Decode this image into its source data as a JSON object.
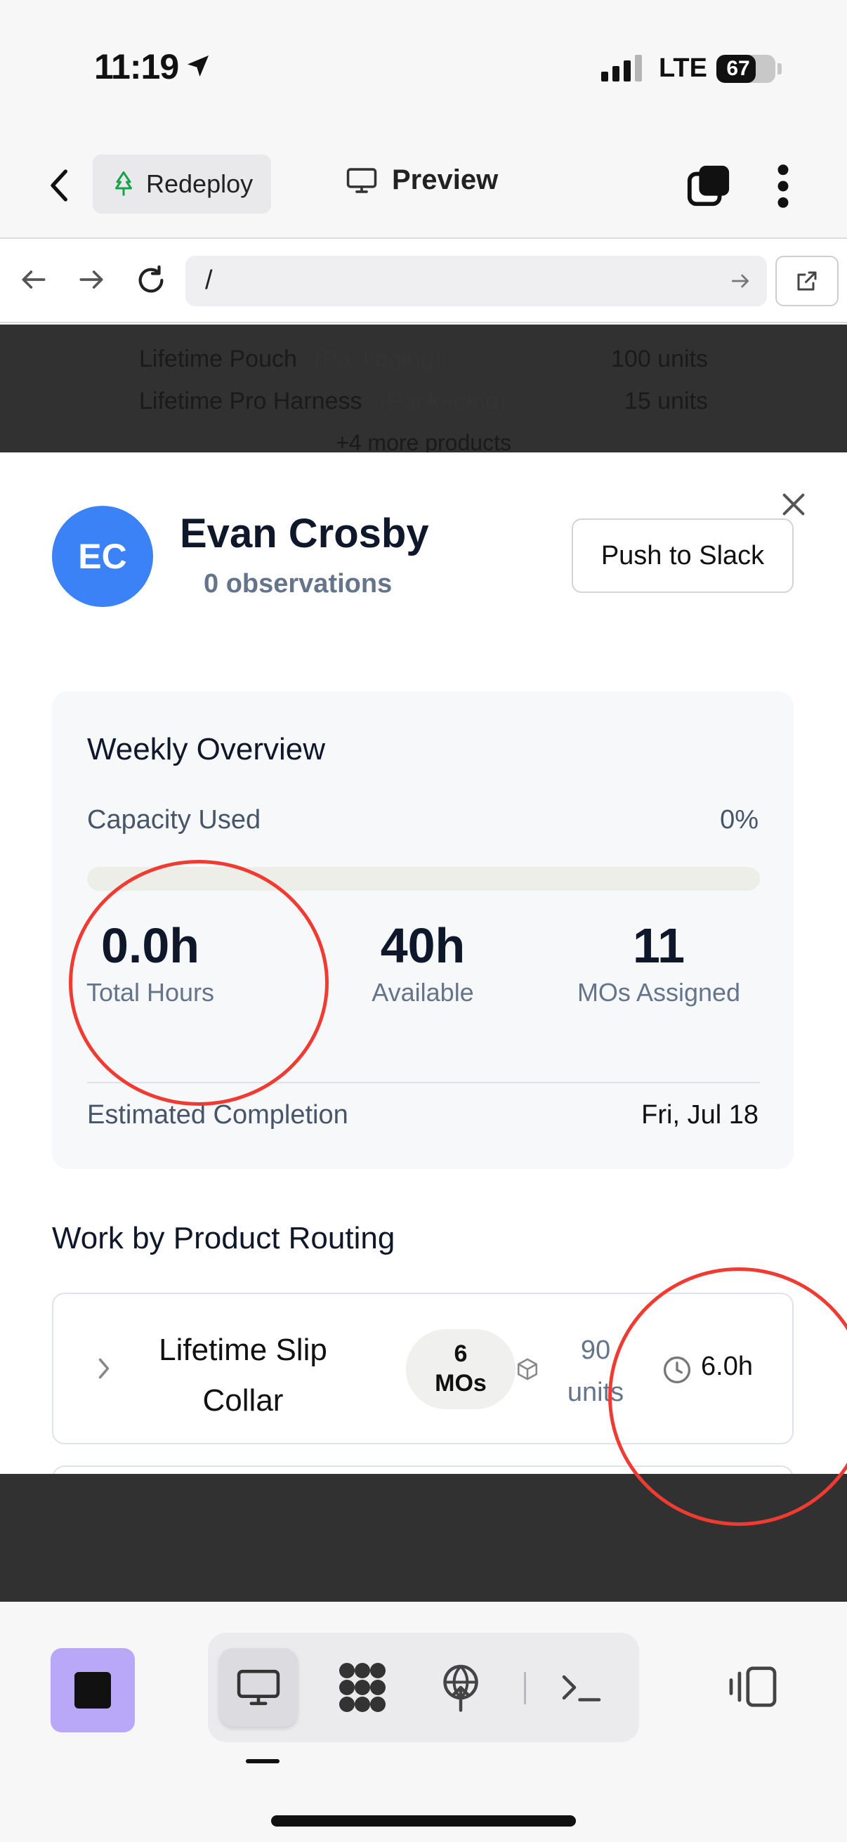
{
  "status_bar": {
    "time": "11:19",
    "network": "LTE",
    "battery": "67",
    "battery_fraction": 0.67
  },
  "top_nav": {
    "redeploy_label": "Redeploy",
    "preview_label": "Preview"
  },
  "url_bar": {
    "path": "/"
  },
  "background_list": {
    "rows": [
      {
        "name": "Lifetime Pouch",
        "category": "(Packaging)",
        "qty": "100 units"
      },
      {
        "name": "Lifetime Pro Harness",
        "category": "(Packaging)",
        "qty": "15 units"
      }
    ],
    "more": "+4 more products"
  },
  "modal": {
    "avatar_initials": "EC",
    "name": "Evan Crosby",
    "observations": "0 observations",
    "push_label": "Push to Slack",
    "weekly": {
      "title": "Weekly Overview",
      "capacity_label": "Capacity Used",
      "capacity_value": "0%",
      "capacity_fraction": 0,
      "stats": [
        {
          "value": "0.0h",
          "label": "Total Hours"
        },
        {
          "value": "40h",
          "label": "Available"
        },
        {
          "value": "11",
          "label": "MOs Assigned"
        }
      ],
      "estimated_label": "Estimated Completion",
      "estimated_value": "Fri, Jul 18"
    },
    "routing": {
      "title": "Work by Product Routing",
      "items": [
        {
          "name": "Lifetime Slip Collar",
          "mos_count": "6",
          "mos_label": "MOs",
          "units": "90 units",
          "hours": "6.0h"
        }
      ]
    }
  },
  "colors": {
    "accent": "#3b82f6",
    "annotation": "#ef3b32",
    "app_tile": "#b9a8f8",
    "redeploy_icon": "#16a34a"
  }
}
